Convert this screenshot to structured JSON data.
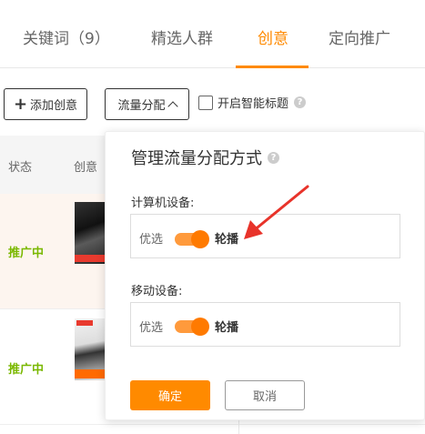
{
  "tabs": [
    {
      "label": "关键词（9）",
      "active": false
    },
    {
      "label": "精选人群",
      "active": false
    },
    {
      "label": "创意",
      "active": true
    },
    {
      "label": "定向推广",
      "active": false
    }
  ],
  "toolbar": {
    "add_label": "添加创意",
    "flow_label": "流量分配",
    "smart_title_label": "开启智能标题",
    "smart_title_checked": false
  },
  "table": {
    "headers": [
      "状态",
      "创意"
    ],
    "rows": [
      {
        "status": "推广中"
      },
      {
        "status": "推广中"
      }
    ]
  },
  "panel": {
    "title": "管理流量分配方式",
    "help_glyph": "?",
    "sections": [
      {
        "label": "计算机设备:",
        "left_option": "优选",
        "right_option": "轮播",
        "toggle_on": true
      },
      {
        "label": "移动设备:",
        "left_option": "优选",
        "right_option": "轮播",
        "toggle_on": true
      }
    ],
    "confirm_label": "确定",
    "cancel_label": "取消"
  },
  "colors": {
    "accent": "#ff8a00",
    "status_active": "#7ab800",
    "annotation": "#e8332a"
  }
}
